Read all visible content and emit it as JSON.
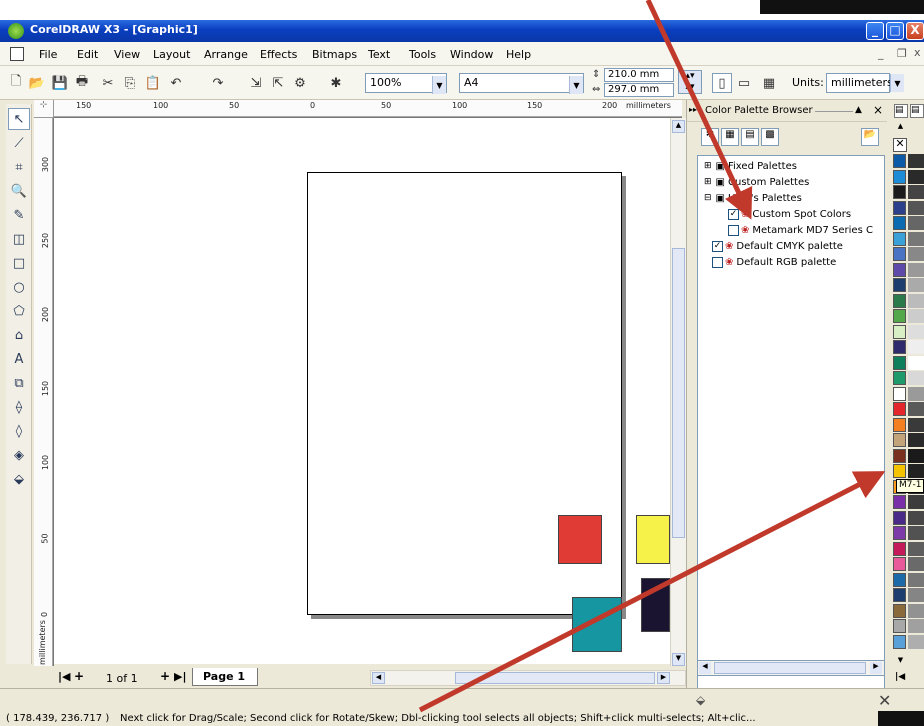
{
  "window": {
    "title": "CorelDRAW X3 - [Graphic1]",
    "buttons": {
      "minimize": "_",
      "maximize": "□",
      "close": "X"
    }
  },
  "menu": {
    "items": [
      "File",
      "Edit",
      "View",
      "Layout",
      "Arrange",
      "Effects",
      "Bitmaps",
      "Text",
      "Tools",
      "Window",
      "Help"
    ]
  },
  "toolbar": {
    "zoom": "100%",
    "paper": "A4",
    "width": "210.0 mm",
    "height": "297.0 mm",
    "units_label": "Units:",
    "units": "millimeters"
  },
  "rulers": {
    "h_ticks": [
      "150",
      "100",
      "50",
      "0",
      "50",
      "100",
      "150",
      "200"
    ],
    "h_unit": "millimeters",
    "v_ticks": [
      "300",
      "250",
      "200",
      "150",
      "100",
      "50",
      "0"
    ],
    "v_unit": "millimeters"
  },
  "page_nav": {
    "counter": "1 of 1",
    "tab": "Page 1"
  },
  "canvas_shapes": [
    {
      "name": "red-square",
      "color": "#e03c35"
    },
    {
      "name": "yellow-square",
      "color": "#f7f24a"
    },
    {
      "name": "teal-square",
      "color": "#1596a0"
    },
    {
      "name": "dark-square",
      "color": "#1a1430"
    }
  ],
  "docker": {
    "title": "Color Palette Browser",
    "tree": [
      {
        "label": "Fixed Palettes",
        "level": 0,
        "type": "folder"
      },
      {
        "label": "Custom Palettes",
        "level": 0,
        "type": "folder"
      },
      {
        "label": "User's Palettes",
        "level": 0,
        "type": "folder"
      },
      {
        "label": "Custom Spot Colors",
        "level": 1,
        "checked": true
      },
      {
        "label": "Metamark MD7 Series C",
        "level": 1,
        "checked": false
      },
      {
        "label": "Default CMYK palette",
        "level": 0,
        "checked": true
      },
      {
        "label": "Default RGB palette",
        "level": 0,
        "checked": false
      }
    ]
  },
  "palette_tooltip": "M7-1",
  "status": {
    "coords": "( 178.439, 236.717 )",
    "message": "Next click for Drag/Scale; Second click for Rotate/Skew; Dbl-clicking tool selects all objects; Shift+click multi-selects; Alt+clic..."
  },
  "annotation_color": "#c0392b"
}
